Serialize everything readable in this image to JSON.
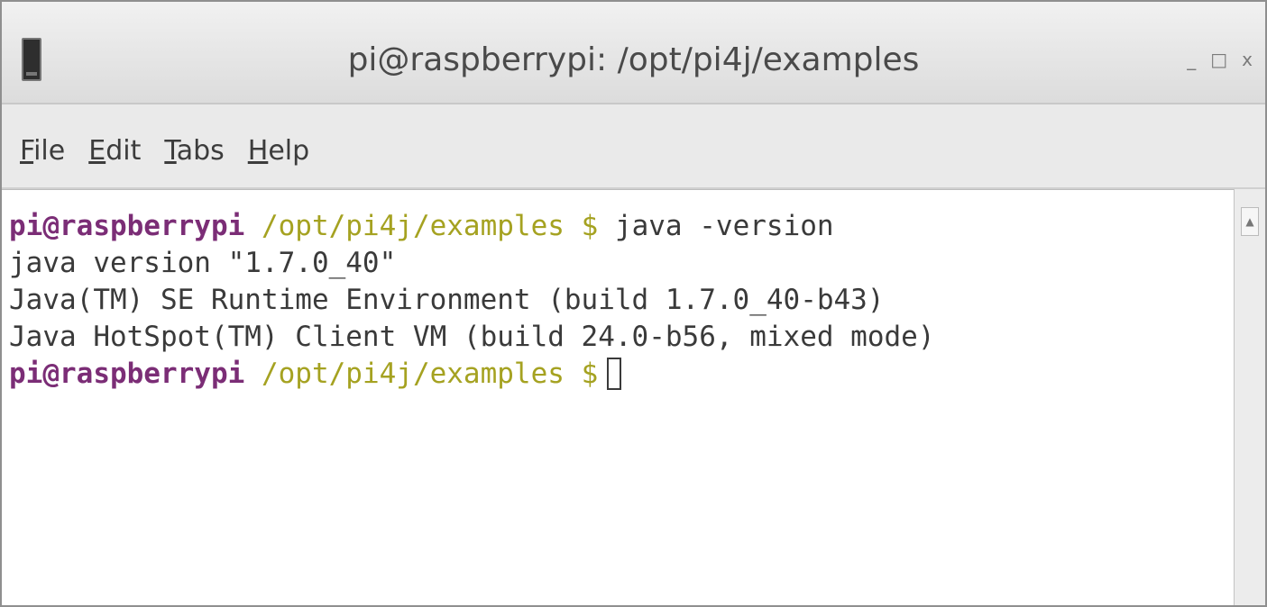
{
  "window": {
    "title": "pi@raspberrypi: /opt/pi4j/examples",
    "controls": {
      "minimize": "_",
      "maximize": "□",
      "close": "x"
    }
  },
  "menu": {
    "items": [
      {
        "mnemonic": "F",
        "rest": "ile"
      },
      {
        "mnemonic": "E",
        "rest": "dit"
      },
      {
        "mnemonic": "T",
        "rest": "abs"
      },
      {
        "mnemonic": "H",
        "rest": "elp"
      }
    ]
  },
  "terminal": {
    "prompt1": {
      "user": "pi@raspberrypi",
      "path": "/opt/pi4j/examples",
      "symbol": "$",
      "command": "java -version"
    },
    "output": [
      "java version \"1.7.0_40\"",
      "Java(TM) SE Runtime Environment (build 1.7.0_40-b43)",
      "Java HotSpot(TM) Client VM (build 24.0-b56, mixed mode)"
    ],
    "prompt2": {
      "user": "pi@raspberrypi",
      "path": "/opt/pi4j/examples",
      "symbol": "$"
    }
  },
  "scrollbar": {
    "up_arrow": "▲"
  },
  "colors": {
    "prompt_user": "#7b2d76",
    "prompt_path": "#a5a221",
    "text": "#3a3a3a"
  }
}
